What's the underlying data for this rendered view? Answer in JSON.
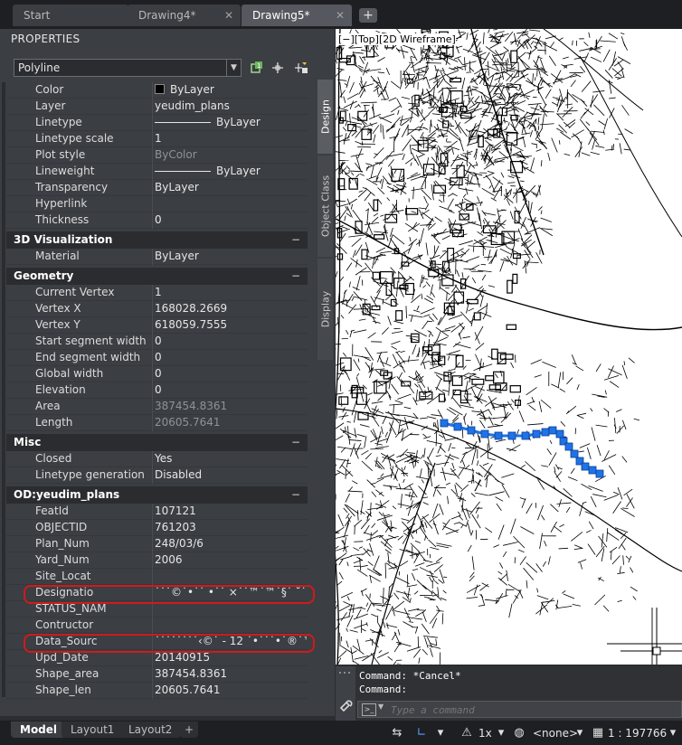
{
  "tabs": [
    {
      "label": "Start",
      "active": false
    },
    {
      "label": "Drawing4*",
      "active": false
    },
    {
      "label": "Drawing5*",
      "active": true
    }
  ],
  "tab_add_label": "+",
  "tab_close_glyph": "✕",
  "palette": {
    "title": "PROPERTIES",
    "object_type": "Polyline",
    "icons": [
      "toggle-pickadd-icon",
      "select-objects-icon",
      "quick-select-icon"
    ]
  },
  "general_rows": [
    {
      "label": "Color",
      "value": "ByLayer",
      "kind": "color"
    },
    {
      "label": "Layer",
      "value": "yeudim_plans"
    },
    {
      "label": "Linetype",
      "value": "ByLayer",
      "kind": "line"
    },
    {
      "label": "Linetype scale",
      "value": "1"
    },
    {
      "label": "Plot style",
      "value": "ByColor",
      "readonly": true
    },
    {
      "label": "Lineweight",
      "value": "ByLayer",
      "kind": "line"
    },
    {
      "label": "Transparency",
      "value": "ByLayer"
    },
    {
      "label": "Hyperlink",
      "value": ""
    },
    {
      "label": "Thickness",
      "value": "0"
    }
  ],
  "sections": {
    "viz": "3D Visualization",
    "geometry": "Geometry",
    "misc": "Misc",
    "od": "OD:yeudim_plans",
    "collapse_glyph": "−"
  },
  "viz_rows": [
    {
      "label": "Material",
      "value": "ByLayer"
    }
  ],
  "geometry_rows": [
    {
      "label": "Current Vertex",
      "value": "1"
    },
    {
      "label": "Vertex X",
      "value": "168028.2669"
    },
    {
      "label": "Vertex Y",
      "value": "618059.7555"
    },
    {
      "label": "Start segment width",
      "value": "0"
    },
    {
      "label": "End segment width",
      "value": "0"
    },
    {
      "label": "Global width",
      "value": "0"
    },
    {
      "label": "Elevation",
      "value": "0"
    },
    {
      "label": "Area",
      "value": "387454.8361",
      "readonly": true
    },
    {
      "label": "Length",
      "value": "20605.7641",
      "readonly": true
    }
  ],
  "misc_rows": [
    {
      "label": "Closed",
      "value": "Yes"
    },
    {
      "label": "Linetype generation",
      "value": "Disabled"
    }
  ],
  "od_rows": [
    {
      "label": "FeatId",
      "value": "107121"
    },
    {
      "label": "OBJECTID",
      "value": "761203"
    },
    {
      "label": "Plan_Num",
      "value": "248/03/6"
    },
    {
      "label": "Yard_Num",
      "value": "2006"
    },
    {
      "label": "Site_Locat",
      "value": ""
    },
    {
      "label": "Designatio",
      "value": "˙˙˙©˙•˙˙ •˙˙ ×˙˙™˙™˙§˙ ˘˙˙˙˙×"
    },
    {
      "label": "STATUS_NAM",
      "value": ""
    },
    {
      "label": "Contructor",
      "value": ""
    },
    {
      "label": "Data_Sourc",
      "value": "˙˙˙˙˙˙˙˙‹©˙ - 12 ˙•˙˙˙•˙®˙™: mi..."
    },
    {
      "label": "Upd_Date",
      "value": "20140915"
    },
    {
      "label": "Shape_area",
      "value": "387454.8361"
    },
    {
      "label": "Shape_len",
      "value": "20605.7641"
    }
  ],
  "side_tabs": [
    "Design",
    "Object Class",
    "Display"
  ],
  "viewport_label": "[−][Top][2D Wireframe]",
  "command": {
    "history": [
      "Command: *Cancel*",
      "Command:"
    ],
    "placeholder": "Type a command"
  },
  "layout_tabs": [
    {
      "label": "Model",
      "active": true
    },
    {
      "label": "Layout1",
      "active": false
    },
    {
      "label": "Layout2",
      "active": false
    }
  ],
  "layout_add_label": "+",
  "status": {
    "annotation_scale": "1x",
    "workspace": "<none>",
    "scale": "1 : 197766"
  }
}
